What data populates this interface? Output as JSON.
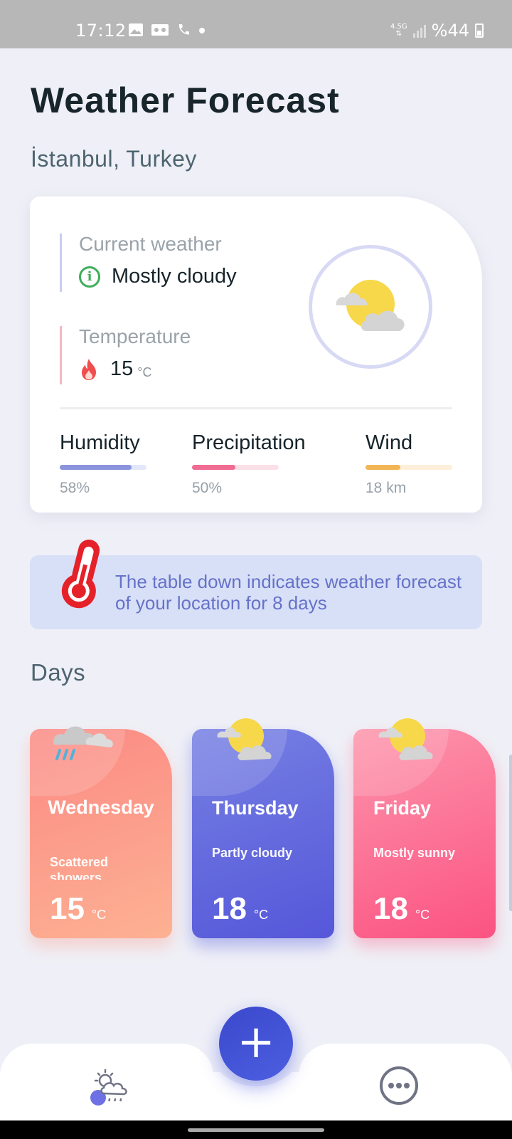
{
  "status_bar": {
    "time": "17:12",
    "network": "4.5G",
    "battery": "%44"
  },
  "header": {
    "title": "Weather Forecast",
    "location": "İstanbul, Turkey"
  },
  "current_card": {
    "current_label": "Current weather",
    "condition": "Mostly cloudy",
    "temp_label": "Temperature",
    "temp_value": "15",
    "temp_unit": "°C",
    "icon": "partly-cloudy-icon",
    "stats": [
      {
        "name": "Humidity",
        "value": "58%",
        "level": 0.83,
        "color": "#8a94dc",
        "track": "#e3e7fa"
      },
      {
        "name": "Precipitation",
        "value": "50%",
        "level": 0.5,
        "color": "#f06c92",
        "track": "#fbe0e8"
      },
      {
        "name": "Wind",
        "value": "18 km",
        "level": 0.4,
        "color": "#f2b556",
        "track": "#fdefd9"
      }
    ]
  },
  "banner": {
    "text": "The table down indicates weather forecast of your location for 8 days",
    "icon": "thermometer-icon"
  },
  "days_section": {
    "label": "Days",
    "days": [
      {
        "name": "Wednesday",
        "condition": "Scattered showers",
        "temp": "15",
        "unit": "°C",
        "icon": "rain-cloud-icon",
        "color": "#fb8a84"
      },
      {
        "name": "Thursday",
        "condition": "Partly cloudy",
        "temp": "18",
        "unit": "°C",
        "icon": "partly-cloudy-icon",
        "color": "#5c61dc"
      },
      {
        "name": "Friday",
        "condition": "Mostly sunny",
        "temp": "18",
        "unit": "°C",
        "icon": "partly-cloudy-icon",
        "color": "#fb6a90"
      }
    ]
  },
  "bottom_nav": {
    "fab_label": "+",
    "items": [
      "weather-nav-icon",
      "more-options-icon"
    ]
  },
  "colors": {
    "background": "#eff0f7",
    "accent": "#3b49cc",
    "banner_bg": "#d8e0f7",
    "banner_text": "#6672c9"
  }
}
